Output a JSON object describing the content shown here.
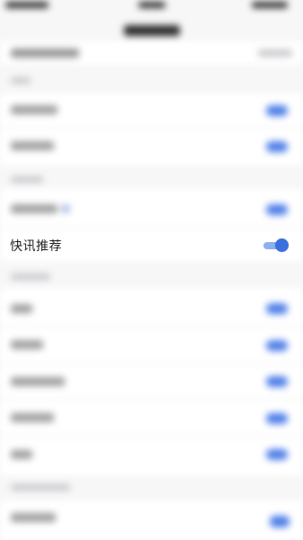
{
  "settings": {
    "focused_item": {
      "label": "快讯推荐",
      "enabled": true
    }
  },
  "colors": {
    "accent": "#3b6fe0",
    "toggle_track": "#8fb0ef",
    "background": "#f7f7f8"
  },
  "icons": {
    "toggle": "toggle-switch-on"
  }
}
